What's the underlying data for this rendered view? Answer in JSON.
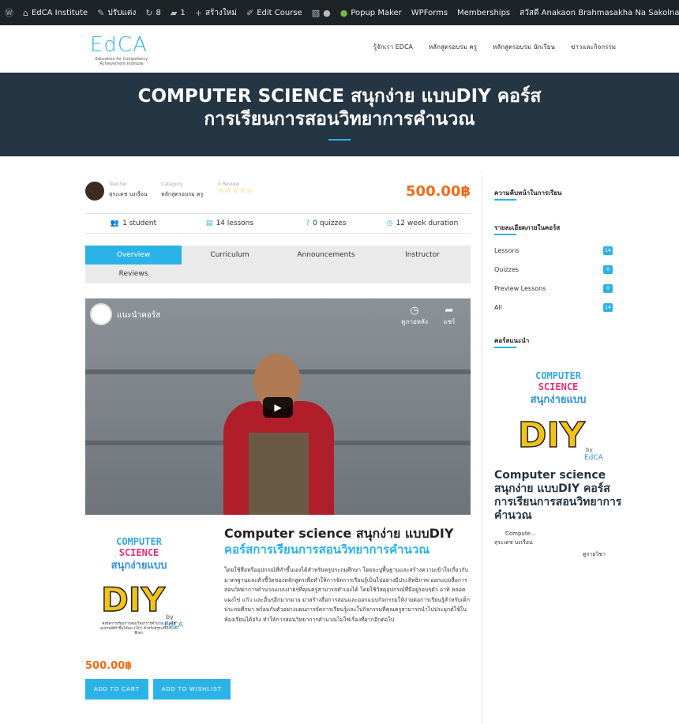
{
  "adminbar": {
    "site": "EdCA Institute",
    "customize": "ปรับแต่ง",
    "updates": "8",
    "comments": "1",
    "new": "สร้างใหม่",
    "edit": "Edit Course",
    "popup": "Popup Maker",
    "wpforms": "WPForms",
    "memberships": "Memberships",
    "greeting": "สวัสดี Anakaon Brahmasakha Na Sakolnagara"
  },
  "logo": {
    "mark": "EdCA",
    "sub": "Education for Competency Achievement Institute"
  },
  "nav": [
    "รู้จักเรา EDCA",
    "หลักสูตรอบรม ครู",
    "หลักสูตรอบรม นักเรียน",
    "ข่าวและกิจกรรม"
  ],
  "hero": {
    "title_line1": "COMPUTER SCIENCE สนุกง่าย แบบDIY คอร์ส",
    "title_line2": "การเรียนการสอนวิทยาการคำนวณ"
  },
  "meta": {
    "teacher_label": "Teacher",
    "teacher": "สุระเดช บงเรือน",
    "category_label": "Category",
    "category": "หลักสูตรอบรม ครู",
    "review_label": "0 Review",
    "stars": "☆☆☆☆☆",
    "price": "500.00฿"
  },
  "stats": [
    "1 student",
    "14 lessons",
    "0 quizzes",
    "12 week duration"
  ],
  "tabs": [
    "Overview",
    "Curriculum",
    "Announcements",
    "Instructor",
    "Reviews"
  ],
  "video": {
    "title": "แนะนำคอร์ส",
    "watch_later": "ดูภายหลัง",
    "share": "แชร์"
  },
  "intro": {
    "title1": "Computer science สนุกง่าย แบบDIY",
    "title2": "คอร์สการเรียนการสอนวิทยาการคำนวณ",
    "desc": "โดยใช้สื่อหรืออุปกรณ์ที่ทำขึ้นเองได้สำหรับครูประถมศึกษา โดยจะปูพื้นฐานและสร้างความเข้าใจเกี่ยวกับมาตรฐานและตัวชี้วัดของหลักสูตรเพื่อทำให้การจัดการเรียนรู้เป็นไปอย่างมีประสิทธิภาพ ออกแบบสื่อการสอนวิทยาการคำนวณแบบง่ายๆที่คุณครูสามารถทำเองได้ โดยใช้วัสดุอุปกรณ์ที่มีอยู่รอบๆตัว อาทิ หลอด แผงไข่ แก้ว และอื่นๆอีกมากมาย มาสร้างสื่อการสอนและออกแบบกิจกรรมให้ง่ายต่อการเรียนรู้สำหรับเด็กประถมศึกษา พร้อมกับตัวอย่างแผนการจัดการเรียนรู้และใบกิจกรรมที่คุณครูสามารถนำไปประยุกต์ใช้ในห้องเรียนได้จริง ทำให้การสอนวิทยาการคำนวณไม่ใช่เรื่องที่ยากอีกต่อไป",
    "img_caption": "คอร์สการเรียนการสอนวิทยาการคำนวณ แบบใช้อุปกรณ์ที่ทำขึ้นได้เอง (DIY) สำหรับครูระดับประถมศึกษา"
  },
  "price_bottom": "500.00฿",
  "buttons": {
    "cart": "ADD TO CART",
    "wishlist": "ADD TO WISHLIST"
  },
  "sidebar": {
    "progress_heading": "ความคืบหน้าในการเรียน",
    "details_heading": "รายละเอียดภายในคอร์ส",
    "rows": [
      {
        "label": "Lessons",
        "count": "14"
      },
      {
        "label": "Quizzes",
        "count": "0"
      },
      {
        "label": "Preview Lessons",
        "count": "0"
      },
      {
        "label": "All",
        "count": "14"
      }
    ],
    "recommended_heading": "คอร์สแนะนำ",
    "course_title": "Computer science สนุกง่าย แบบDIY คอร์สการเรียนการสอนวิทยาการคำนวณ",
    "course_excerpt": "Compute...",
    "course_teacher": "สุระเดช บงเรือน",
    "view_link": "ดูรายวิชา"
  },
  "art": {
    "line1": "COMPUTER",
    "line2": "SCIENCE",
    "line3": "สนุกง่ายแบบ",
    "diy": "DIY",
    "by": "by",
    "edca": "EdCA"
  }
}
